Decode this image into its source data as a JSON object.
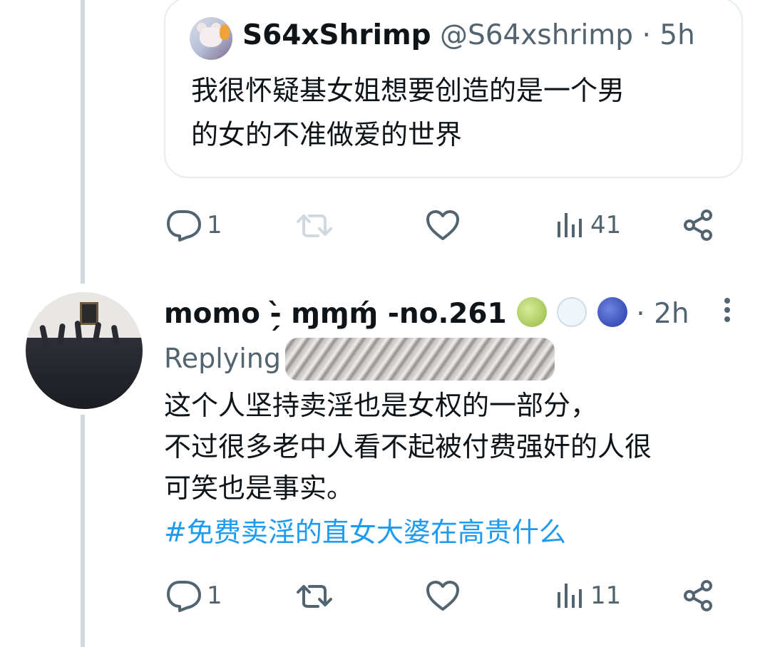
{
  "quoted_tweet": {
    "display_name": "S64xShrimp",
    "handle": "@S64xshrimp",
    "separator": "·",
    "time": "5h",
    "text_lines": [
      "我很怀疑基女姐想要创造的是一个男",
      "的女的不准做爱的世界"
    ]
  },
  "actions_top": {
    "reply_count": "1",
    "retweet_count": "",
    "like_count": "",
    "views_count": "41"
  },
  "reply": {
    "display_name": "momo -̗̀ ɱɱɱ́ -no.261",
    "emojis": [
      "melon-emoji",
      "polar-bear-emoji",
      "blueberries-emoji"
    ],
    "separator": "·",
    "time": "2h",
    "replying_label": "Replying",
    "text_lines": [
      "这个人坚持卖淫也是女权的一部分，",
      "不过很多老中人看不起被付费强奸的人很",
      "可笑也是事实。"
    ],
    "hashtag": "#免费卖淫的直女大婆在高贵什么"
  },
  "actions_bottom": {
    "reply_count": "1",
    "retweet_count": "",
    "like_count": "",
    "views_count": "11"
  },
  "colors": {
    "text": "#0f1419",
    "muted": "#536471",
    "link": "#1d9bf0",
    "border": "#e6ecf0",
    "thread_line": "#cfd9de"
  },
  "icons": [
    "reply-icon",
    "retweet-icon",
    "like-icon",
    "views-icon",
    "share-icon",
    "more-vertical-icon"
  ]
}
